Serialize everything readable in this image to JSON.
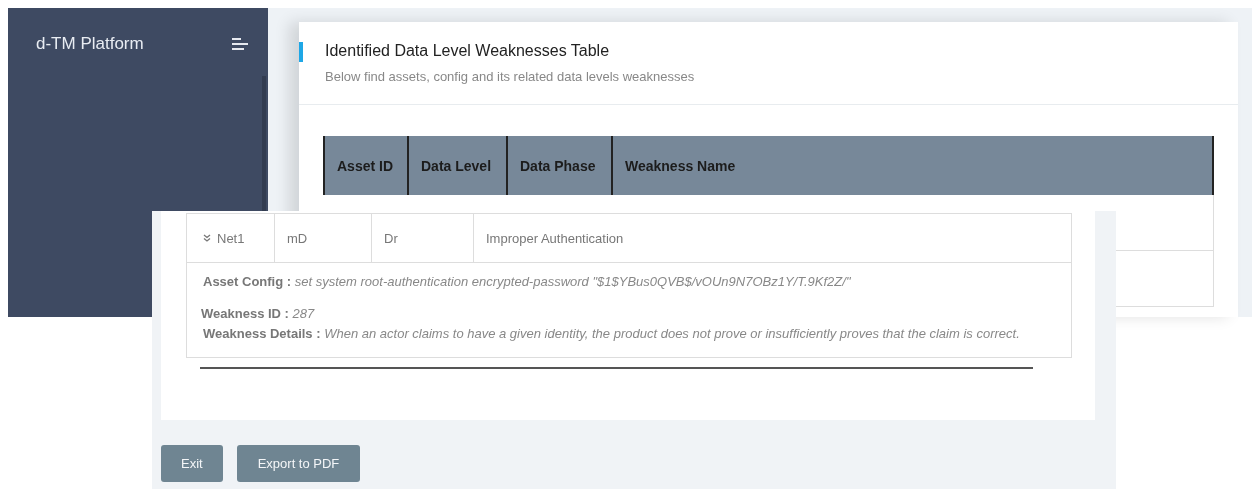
{
  "sidebar": {
    "title": "d-TM Platform"
  },
  "card": {
    "title": "Identified Data Level Weaknesses Table",
    "subtitle": "Below find assets, config and its related data levels weaknesses"
  },
  "table": {
    "columns": [
      "Asset ID",
      "Data Level",
      "Data Phase",
      "Weakness Name"
    ]
  },
  "detail_panel": {
    "row": {
      "expanded": true,
      "cells": [
        "Net1",
        "mD",
        "Dr",
        "Improper Authentication"
      ]
    },
    "fields": [
      {
        "label": "Asset Config :",
        "value": "set system root-authentication encrypted-password \"$1$YBus0QVB$/vOUn9N7OBz1Y/T.9Kf2Z/\""
      },
      {
        "label": "Weakness ID :",
        "value": "287"
      },
      {
        "label": "Weakness Details :",
        "value": "When an actor claims to have a given identity, the product does not prove or insufficiently proves that the claim is correct."
      }
    ]
  },
  "buttons": [
    "Exit",
    "Export to PDF"
  ]
}
